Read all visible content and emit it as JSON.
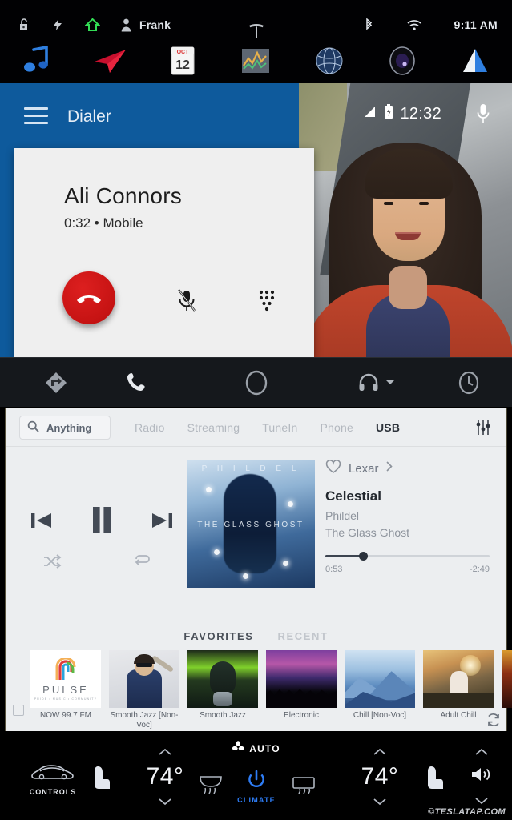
{
  "tesla_status": {
    "icons": [
      "unlock-icon",
      "lightning-bolt-icon",
      "home-icon",
      "driver-profile-icon"
    ],
    "driver_name": "Frank",
    "center_logo": "tesla-logo",
    "right_icons": [
      "bluetooth-icon",
      "wifi-icon"
    ],
    "clock": "9:11 AM"
  },
  "tesla_apps": [
    {
      "name": "media-app",
      "label": "Media"
    },
    {
      "name": "navigation-app",
      "label": "Navigation"
    },
    {
      "name": "calendar-app",
      "label": "Calendar",
      "month": "OCT",
      "day": "12"
    },
    {
      "name": "energy-app",
      "label": "Energy"
    },
    {
      "name": "web-browser-app",
      "label": "Web"
    },
    {
      "name": "camera-app",
      "label": "Camera"
    },
    {
      "name": "android-auto-app",
      "label": "Android Auto"
    }
  ],
  "dialer": {
    "title": "Dialer",
    "menu_icon": "hamburger-menu-icon",
    "status": {
      "signal_icon": "cellular-signal-icon",
      "battery_icon": "battery-charging-icon",
      "time": "12:32",
      "mic_icon": "microphone-icon"
    },
    "call": {
      "contact_name": "Ali Connors",
      "call_info": "0:32 • Mobile",
      "duration": "0:32",
      "line_type": "Mobile",
      "buttons": [
        {
          "name": "hang-up-button",
          "icon": "phone-hangup-icon",
          "color": "#c61313"
        },
        {
          "name": "mute-button",
          "icon": "microphone-muted-icon"
        },
        {
          "name": "keypad-button",
          "icon": "dialpad-icon"
        }
      ]
    },
    "header_color": "#0e5a9c"
  },
  "aa_nav": [
    {
      "name": "nav-maps-button",
      "icon": "navigation-arrow-icon"
    },
    {
      "name": "nav-phone-button",
      "icon": "phone-icon"
    },
    {
      "name": "nav-home-button",
      "icon": "home-circle-icon"
    },
    {
      "name": "nav-media-button",
      "icon": "headphones-icon",
      "has_chevron": true
    },
    {
      "name": "nav-recent-button",
      "icon": "clock-icon"
    }
  ],
  "media": {
    "search": {
      "placeholder": "Anything",
      "icon": "search-icon"
    },
    "tabs": [
      {
        "label": "Radio",
        "active": false
      },
      {
        "label": "Streaming",
        "active": false
      },
      {
        "label": "TuneIn",
        "active": false
      },
      {
        "label": "Phone",
        "active": false
      },
      {
        "label": "USB",
        "active": true
      }
    ],
    "equalizer_icon": "equalizer-icon",
    "now_playing": {
      "favorite_icon": "heart-outline-icon",
      "source": "Lexar",
      "source_chevron": "chevron-right-icon",
      "title": "Celestial",
      "artist": "Phildel",
      "album": "The Glass Ghost",
      "elapsed": "0:53",
      "remaining": "-2:49",
      "progress_percent": 22,
      "album_art": {
        "top_text": "P H I L D E L",
        "mid_text": "THE GLASS GHOST"
      },
      "controls": [
        {
          "name": "previous-track-button",
          "icon": "skip-previous-icon"
        },
        {
          "name": "pause-button",
          "icon": "pause-icon"
        },
        {
          "name": "next-track-button",
          "icon": "skip-next-icon"
        },
        {
          "name": "shuffle-button",
          "icon": "shuffle-icon"
        },
        {
          "name": "repeat-button",
          "icon": "repeat-icon"
        }
      ]
    },
    "favorites_tabs": [
      {
        "label": "FAVORITES",
        "active": true
      },
      {
        "label": "RECENT",
        "active": false
      }
    ],
    "tiles": [
      {
        "label": "NOW  99.7 FM",
        "art": "pulse",
        "brand": "PULSE",
        "tagline": "PRIDE • MUSIC • COMMUNITY"
      },
      {
        "label": "Smooth Jazz [Non-Voc]",
        "art": "jazz1"
      },
      {
        "label": "Smooth Jazz",
        "art": "jazz2"
      },
      {
        "label": "Electronic",
        "art": "electronic"
      },
      {
        "label": "Chill [Non-Voc]",
        "art": "chill"
      },
      {
        "label": "Adult Chill",
        "art": "adultchill"
      }
    ],
    "refresh_icon": "refresh-icon"
  },
  "climate": {
    "controls_label": "CONTROLS",
    "controls_icon": "car-icon",
    "left_seat_icon": "seat-heater-icon",
    "right_seat_icon": "seat-heater-icon",
    "left_temp": "74°",
    "right_temp": "74°",
    "auto_label": "AUTO",
    "fan_icon": "fan-icon",
    "climate_label": "CLIMATE",
    "power_icon": "power-icon",
    "front_defrost_icon": "front-defroster-icon",
    "rear_defrost_icon": "rear-defroster-icon",
    "volume_icon": "volume-icon",
    "chevron_up_icon": "chevron-up-icon",
    "chevron_down_icon": "chevron-down-icon",
    "accent_color": "#2e7df6"
  },
  "watermark": "©TESLATAP.COM"
}
